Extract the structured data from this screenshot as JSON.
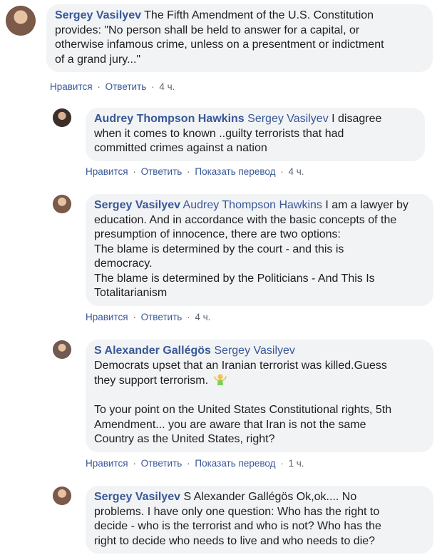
{
  "actions": {
    "like": "Нравится",
    "reply": "Ответить",
    "translate": "Показать перевод",
    "separator": "·"
  },
  "comments": [
    {
      "author": "Sergey Vasilyev",
      "mention": "",
      "lines": [
        "The Fifth Amendment of the U.S. Constitution",
        "provides: \"No person shall be held to answer for a capital, or",
        "otherwise infamous crime, unless on a presentment or indictment",
        "of a grand jury...\""
      ],
      "time": "4 ч."
    },
    {
      "author": "Audrey Thompson Hawkins",
      "mention": "Sergey Vasilyev",
      "lines": [
        "I disagree",
        "when it comes to known ..guilty terrorists that had",
        "committed crimes against a nation"
      ],
      "time": "4 ч."
    },
    {
      "author": "Sergey Vasilyev",
      "mention": "Audrey Thompson Hawkins",
      "lines": [
        "I am a lawyer by",
        "education. And in accordance with the basic concepts of the",
        "presumption of innocence, there are two options:",
        "The blame is determined by the court - and this is",
        "democracy.",
        "The blame is determined by the Politicians - And This Is",
        "Totalitarianism"
      ],
      "time": "4 ч."
    },
    {
      "author": "S Alexander Gallégös",
      "mention": "Sergey Vasilyev",
      "lines": [
        "Democrats upset that an Iranian terrorist was killed.Guess",
        "they support terrorism.",
        "",
        "To your point on the United States Constitutional rights, 5th",
        "Amendment... you are aware that Iran is not the same",
        "Country as the United States, right?"
      ],
      "emoji": "person-shrugging-emoji",
      "time": "1 ч."
    },
    {
      "author": "Sergey Vasilyev",
      "mention": "",
      "lines": [
        "S Alexander Gallégös Ok,ok.... No",
        "problems. I have only one question: Who has the right to",
        "decide - who is the terrorist and who is not? Who has the",
        "right to decide who needs to live and who needs to die?"
      ]
    }
  ]
}
